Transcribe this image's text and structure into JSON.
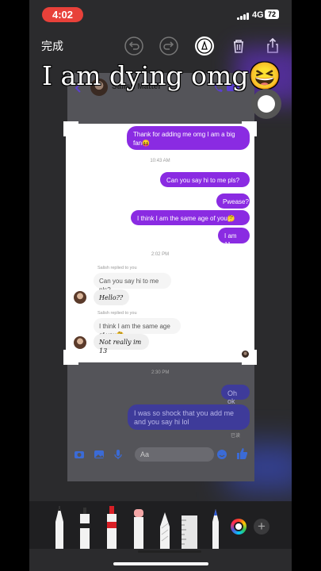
{
  "status": {
    "time": "4:02",
    "network": "4G",
    "battery": "72"
  },
  "toolbar": {
    "done_label": "完成"
  },
  "overlay_text": "I am dying omg😆",
  "background_chat": {
    "contact_name": "Salish Matter",
    "timestamp_bottom": "2:30 PM",
    "message_ohok": "Oh ok",
    "message_shock": "I was so shock that you add me and you say hi lol",
    "read_status": "已读",
    "compose_placeholder": "Aa"
  },
  "crop_chat": {
    "messages_top": [
      {
        "text": "Thank for adding me omg I am a big fan😝"
      },
      {
        "text": "Can you say hi to me pls?"
      },
      {
        "text": "Pwease?"
      },
      {
        "text": "I think I am the same age of you🤔"
      },
      {
        "text": "I am 11"
      }
    ],
    "time_1": "10:43 AM",
    "time_2": "2:02 PM",
    "reply_1": {
      "label": "Salish replied to you",
      "quoted": "Can you say hi to me pls?",
      "answer": "Hello??"
    },
    "reply_2": {
      "label": "Salish replied to you",
      "quoted": "I think I am the same age of you🤔",
      "answer": "Not really im 13"
    }
  },
  "colors": {
    "accent": "#8a2be2",
    "time_pill": "#e8413a"
  }
}
